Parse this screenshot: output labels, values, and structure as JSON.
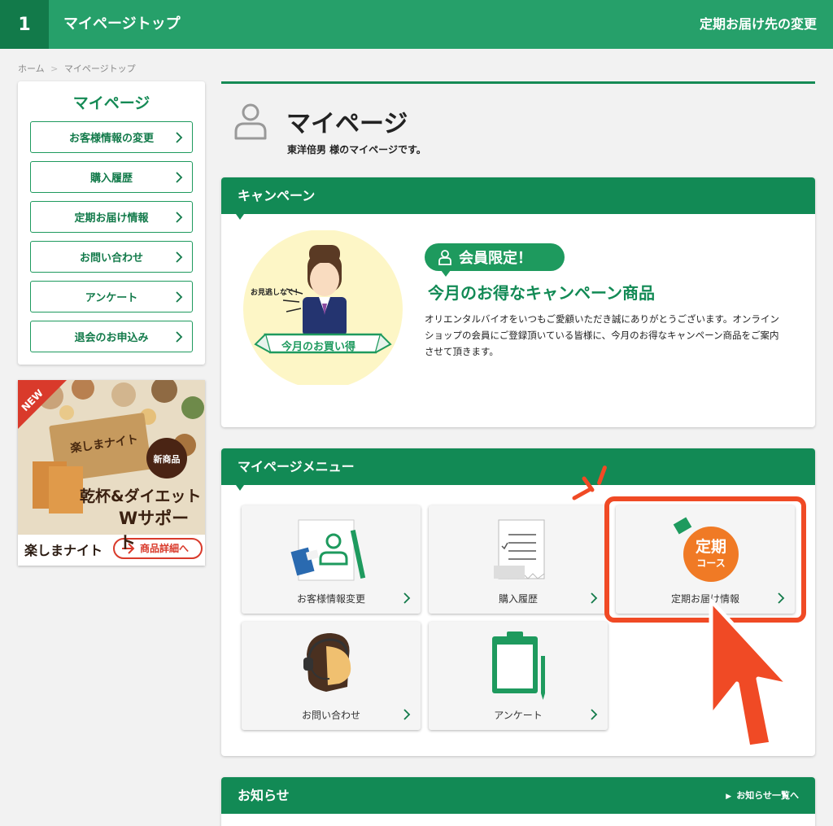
{
  "topbar": {
    "step": "1",
    "title": "マイページトップ",
    "right_link": "定期お届け先の変更"
  },
  "breadcrumb": {
    "home": "ホーム",
    "sep": ">",
    "current": "マイページトップ"
  },
  "sidebar": {
    "title": "マイページ",
    "items": [
      {
        "label": "お客様情報の変更"
      },
      {
        "label": "購入履歴"
      },
      {
        "label": "定期お届け情報"
      },
      {
        "label": "お問い合わせ"
      },
      {
        "label": "アンケート"
      },
      {
        "label": "退会のお申込み"
      }
    ],
    "banner": {
      "new": "NEW",
      "brand_small": "新商品",
      "headline1": "乾杯&ダイエット",
      "headline2": "Wサポート",
      "product": "楽しまナイト",
      "cta": "商品詳細へ",
      "box_text": "楽しまナイト"
    }
  },
  "header": {
    "title": "マイページ",
    "subtitle": "東洋倍男 様のマイページです。"
  },
  "campaign": {
    "head": "キャンペーン",
    "badge": "会員限定！",
    "title": "今月のお得なキャンペーン商品",
    "desc": "オリエンタルバイオをいつもご愛顧いただき誠にありがとうございます。オンラインショップの会員にご登録頂いている皆様に、今月のお得なキャンペーン商品をご案内させて頂きます。",
    "bubble": "お見逃しなく！",
    "ribbon": "今月のお買い得"
  },
  "menu": {
    "head": "マイページメニュー",
    "tiles": [
      {
        "label": "お客様情報変更"
      },
      {
        "label": "購入履歴"
      },
      {
        "label": "定期お届け情報",
        "badge_line1": "定期",
        "badge_line2": "コース"
      },
      {
        "label": "お問い合わせ"
      },
      {
        "label": "アンケート"
      }
    ]
  },
  "news": {
    "head": "お知らせ",
    "link": "お知らせ一覧へ"
  },
  "colors": {
    "brand_green": "#128a55",
    "highlight": "#f04a25"
  }
}
